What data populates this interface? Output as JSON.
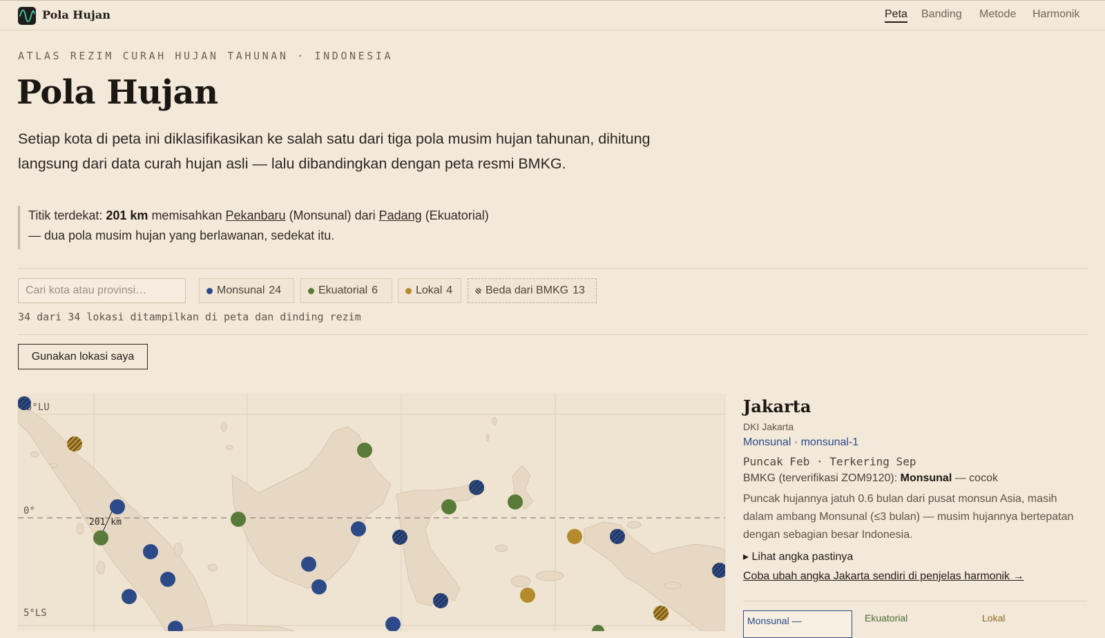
{
  "app": {
    "brand": "Pola Hujan",
    "nav": [
      "Peta",
      "Banding",
      "Metode",
      "Harmonik"
    ],
    "active_nav": "Peta"
  },
  "hero": {
    "eyebrow": "ATLAS REZIM CURAH HUJAN TAHUNAN · INDONESIA",
    "title": "Pola Hujan",
    "intro": "Setiap kota di peta ini diklasifikasikan ke salah satu dari tiga pola musim hujan tahunan, dihitung langsung dari data curah hujan asli — lalu dibandingkan dengan peta resmi BMKG."
  },
  "callout": {
    "prefix": "Titik terdekat: ",
    "distance": "201 km",
    "mid1": " memisahkan ",
    "city_a": "Pekanbaru",
    "mid2": " (Monsunal) dari ",
    "city_b": "Padang",
    "suffix": " (Ekuatorial) — dua pola musim hujan yang berlawanan, sedekat itu."
  },
  "filters": {
    "search_placeholder": "Cari kota atau provinsi…",
    "search_value": "",
    "chips": [
      {
        "label": "Monsunal",
        "count": "24",
        "color": "#2b4a87"
      },
      {
        "label": "Ekuatorial",
        "count": "6",
        "color": "#5a7a3a"
      },
      {
        "label": "Lokal",
        "count": "4",
        "color": "#b48a2c"
      },
      {
        "label": "Beda dari BMKG",
        "count": "13",
        "pattern": "hatched"
      }
    ],
    "count_text": "34 dari 34 lokasi ditampilkan di peta dan dinding rezim",
    "locate_button": "Gunakan lokasi saya"
  },
  "map": {
    "labels": {
      "north": "5°LU",
      "equator": "0°",
      "south": "5°LS",
      "distance": "201 km"
    },
    "colors": {
      "monsunal": "#2b4a87",
      "ekuatorial": "#5a7a3a",
      "lokal": "#b48a2c",
      "land": "#e6d8c3",
      "sea": "#efe4d2"
    }
  },
  "detail": {
    "city": "Jakarta",
    "province": "DKI Jakarta",
    "regime": "Monsunal · monsunal-1",
    "peak_dry": "Puncak Feb · Terkering Sep",
    "bmkg_prefix": "BMKG (terverifikasi ZOM9120): ",
    "bmkg_regime": "Monsunal",
    "bmkg_suffix": " — cocok",
    "description": "Puncak hujannya jatuh 0.6 bulan dari pusat monsun Asia, masih dalam ambang Monsunal (≤3 bulan) — musim hujannya bertepatan dengan sebagian besar Indonesia.",
    "details_label": "Lihat angka pastinya",
    "harmonic_link": "Coba ubah angka Jakarta sendiri di penjelas harmonik →",
    "mini": {
      "monsunal": "Monsunal —",
      "ekuatorial": "Ekuatorial",
      "lokal": "Lokal"
    }
  }
}
